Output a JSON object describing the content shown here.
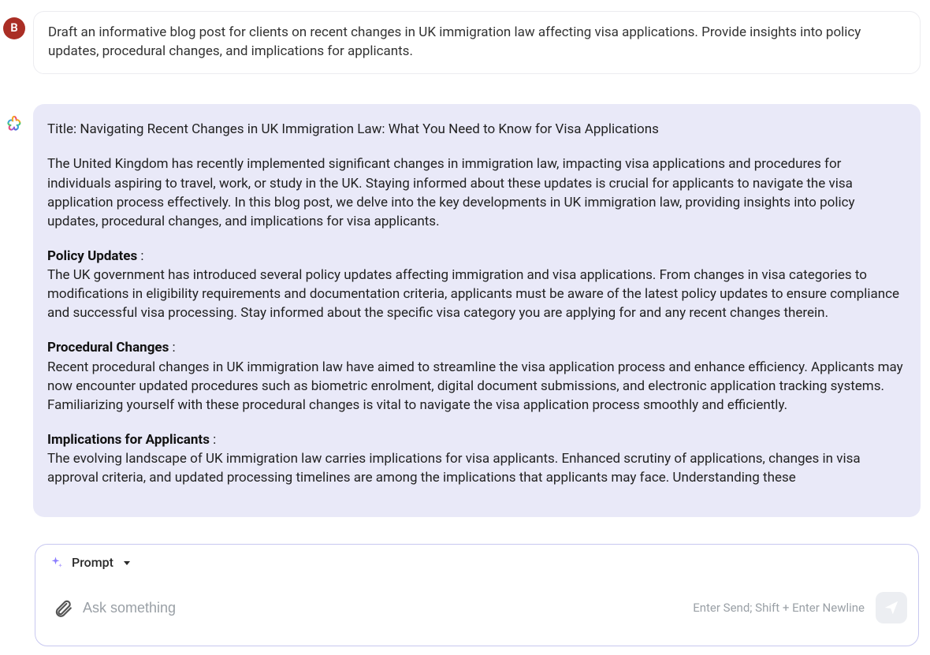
{
  "user": {
    "avatar_initial": "B",
    "message": "Draft an informative blog post for clients on recent changes in UK immigration law affecting visa applications. Provide insights into policy updates, procedural changes, and implications for applicants."
  },
  "assistant": {
    "title": "Title: Navigating Recent Changes in UK Immigration Law: What You Need to Know for Visa Applications",
    "intro": "The United Kingdom has recently implemented significant changes in immigration law, impacting visa applications and procedures for individuals aspiring to travel, work, or study in the UK. Staying informed about these updates is crucial for applicants to navigate the visa application process effectively. In this blog post, we delve into the key developments in UK immigration law, providing insights into policy updates, procedural changes, and implications for visa applicants.",
    "sections": {
      "policy": {
        "heading": "Policy Updates",
        "suffix": " :",
        "body": "The UK government has introduced several policy updates affecting immigration and visa applications. From changes in visa categories to modifications in eligibility requirements and documentation criteria, applicants must be aware of the latest policy updates to ensure compliance and successful visa processing. Stay informed about the specific visa category you are applying for and any recent changes therein."
      },
      "procedural": {
        "heading": "Procedural Changes",
        "suffix": " :",
        "body": "Recent procedural changes in UK immigration law have aimed to streamline the visa application process and enhance efficiency. Applicants may now encounter updated procedures such as biometric enrolment, digital document submissions, and electronic application tracking systems. Familiarizing yourself with these procedural changes is vital to navigate the visa application process smoothly and efficiently."
      },
      "implications": {
        "heading": "Implications for Applicants",
        "suffix": " :",
        "body": "The evolving landscape of UK immigration law carries implications for visa applicants. Enhanced scrutiny of applications, changes in visa approval criteria, and updated processing timelines are among the implications that applicants may face. Understanding these"
      }
    }
  },
  "input_bar": {
    "prompt_label": "Prompt",
    "placeholder": "Ask something",
    "hint": "Enter Send; Shift + Enter Newline"
  }
}
